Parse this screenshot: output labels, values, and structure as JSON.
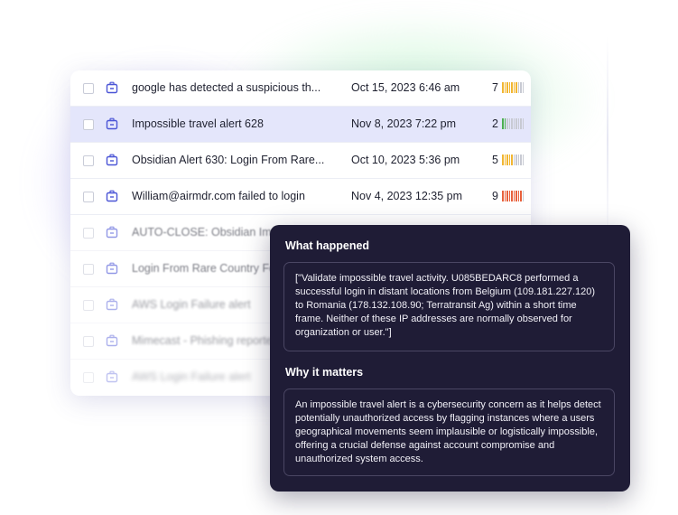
{
  "alerts": [
    {
      "title": "google has detected a suspicious th...",
      "date": "Oct 15, 2023 6:46 am",
      "score": "7",
      "level": 7,
      "color": "#f2b632"
    },
    {
      "title": "Impossible travel alert 628",
      "date": "Nov 8, 2023 7:22 pm",
      "score": "2",
      "level": 2,
      "color": "#4caf50"
    },
    {
      "title": "Obsidian Alert 630: Login From Rare...",
      "date": "Oct 10, 2023 5:36 pm",
      "score": "5",
      "level": 5,
      "color": "#f2b632"
    },
    {
      "title": "William@airmdr.com failed to login",
      "date": "Nov 4, 2023 12:35 pm",
      "score": "9",
      "level": 9,
      "color": "#e8613c"
    },
    {
      "title": "AUTO-CLOSE: Obsidian Impo",
      "date": "",
      "score": "",
      "level": 0,
      "color": "#c8cad3"
    },
    {
      "title": "Login From Rare Country For U",
      "date": "",
      "score": "",
      "level": 0,
      "color": "#c8cad3"
    },
    {
      "title": "AWS Login Failure alert",
      "date": "",
      "score": "",
      "level": 0,
      "color": "#c8cad3"
    },
    {
      "title": "Mimecast - Phishing reported",
      "date": "",
      "score": "",
      "level": 0,
      "color": "#c8cad3"
    },
    {
      "title": "AWS Login Failure alert",
      "date": "",
      "score": "",
      "level": 0,
      "color": "#c8cad3"
    }
  ],
  "details": {
    "what_happened_heading": "What happened",
    "what_happened_text": "[\"Validate impossible travel activity. U085BEDARC8 performed a successful login in distant locations from Belgium (109.181.227.120) to Romania (178.132.108.90; Terratransit Ag) within a short time frame. Neither of these IP addresses are normally observed for organization or user.\"]",
    "why_it_matters_heading": "Why it matters",
    "why_it_matters_text": "An impossible travel alert is a cybersecurity concern as it helps detect potentially unauthorized access by flagging instances where a users geographical movements seem implausible or logistically impossible, offering a crucial defense against account compromise and unauthorized system access."
  },
  "colors": {
    "accent": "#4b55d6",
    "selected_row": "#e4e6fb",
    "panel_bg": "#1f1c36"
  }
}
